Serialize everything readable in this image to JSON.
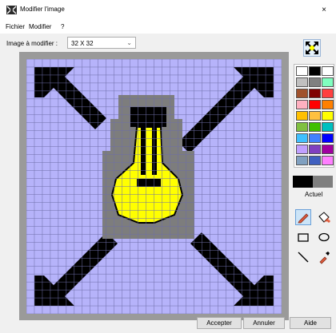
{
  "window": {
    "title": "Modifier l'image",
    "close_glyph": "×"
  },
  "menu": {
    "items": [
      "Fichier",
      "Modifier",
      "?"
    ]
  },
  "image_size": {
    "label": "Image à modifier :",
    "selected": "32 X 32",
    "chevron": "⌄"
  },
  "palette": {
    "colors": [
      "#ffffff",
      "#000000",
      "#ffffff",
      "#c0c0c0",
      "#808080",
      "#80ffc0",
      "#a0522d",
      "#800000",
      "#ff4040",
      "#ffb0c0",
      "#ff0000",
      "#ff8000",
      "#ffc000",
      "#ffc040",
      "#ffff00",
      "#80c040",
      "#40c000",
      "#00c0c0",
      "#40c0ff",
      "#4080ff",
      "#0000ff",
      "#c0a0ff",
      "#8040c0",
      "#a000a0",
      "#80a0c0",
      "#4060c0",
      "#ff80ff"
    ]
  },
  "current": {
    "label": "Actuel",
    "foreground": "#000000",
    "background": "#7f7f7f"
  },
  "tools": [
    {
      "name": "pencil-tool",
      "icon": "pencil-icon"
    },
    {
      "name": "fill-tool",
      "icon": "paint-bucket-icon"
    },
    {
      "name": "rectangle-tool",
      "icon": "rectangle-icon"
    },
    {
      "name": "ellipse-tool",
      "icon": "ellipse-icon"
    },
    {
      "name": "line-tool",
      "icon": "line-icon"
    },
    {
      "name": "color-picker-tool",
      "icon": "eyedropper-icon"
    }
  ],
  "buttons": {
    "accept": "Accepter",
    "cancel": "Annuler",
    "help": "Aide"
  },
  "colors": {
    "canvas_bg": "#b6b3fa",
    "frame": "#9a9a9a",
    "bulb": "#ffff00",
    "arrows": "#000000"
  }
}
